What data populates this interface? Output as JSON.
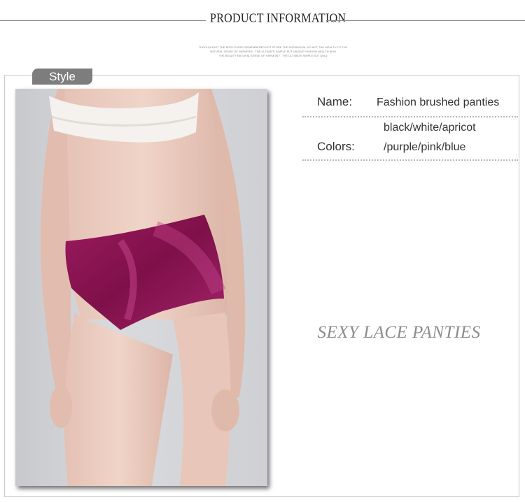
{
  "header": {
    "title": "PRODUCT INFORMATION",
    "tagline": [
      "THROUGHOUT THE BODY EVERY REMEMBERED NOT STORE THE ASPIRATION, DO NOT THE WEALTH TO THE",
      "NATURAL SENSE OF HARMONY , THE ULTIMATE SIMPLE BUT UNIQUE FASHION HEALTH SKIN",
      "THE BEAUTY NATURAL SENSE OF HARMONY , THE ULTIMATE SIMPLE BUT UNIQ"
    ]
  },
  "style_tag": "Style",
  "product": {
    "name_label": "Name:",
    "name_value": "Fashion brushed panties",
    "colors_label": "Colors:",
    "colors_line1": "black/white/apricot",
    "colors_line2": "/purple/pink/blue"
  },
  "slogan": "SEXY LACE PANTIES",
  "colors": {
    "garment": "#8a1553",
    "tag_bg": "#7d7d7d",
    "photo_bg": "#d2d3d6"
  }
}
